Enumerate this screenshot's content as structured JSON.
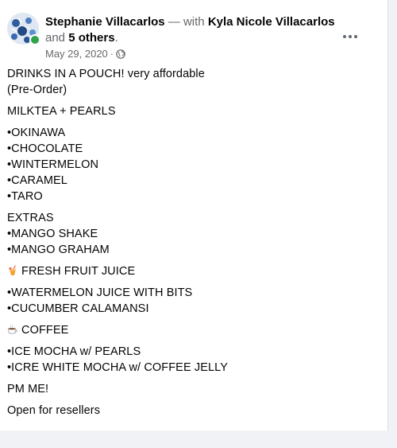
{
  "post": {
    "author": "Stephanie Villacarlos",
    "with_text": "— with",
    "tagged_person": "Kyla Nicole Villacarlos",
    "and_text": "and",
    "others": "5 others",
    "period": ".",
    "date": "May 29, 2020",
    "separator": "·",
    "privacy_icon": "globe-icon",
    "more_icon": "more-horizontal-icon",
    "online_color": "#31a24c"
  },
  "content": {
    "intro_1": "DRINKS IN A POUCH! very affordable",
    "intro_2": "(Pre-Order)",
    "section_1": "MILKTEA + PEARLS",
    "milktea": [
      "•OKINAWA",
      "•CHOCOLATE",
      "•WINTERMELON",
      "•CARAMEL",
      "•TARO"
    ],
    "extras_title": "EXTRAS",
    "extras": [
      "•MANGO SHAKE",
      "•MANGO GRAHAM"
    ],
    "juice_icon": "tropical-drink-emoji",
    "juice_title": "FRESH FRUIT JUICE",
    "juice": [
      "•WATERMELON JUICE WITH BITS",
      "•CUCUMBER CALAMANSI"
    ],
    "coffee_icon": "hot-beverage-emoji",
    "coffee_title": "COFFEE",
    "coffee": [
      "•ICE MOCHA w/ PEARLS",
      "•ICRE WHITE MOCHA w/ COFFEE JELLY"
    ],
    "pm": "PM ME!",
    "resellers": "Open for resellers"
  }
}
